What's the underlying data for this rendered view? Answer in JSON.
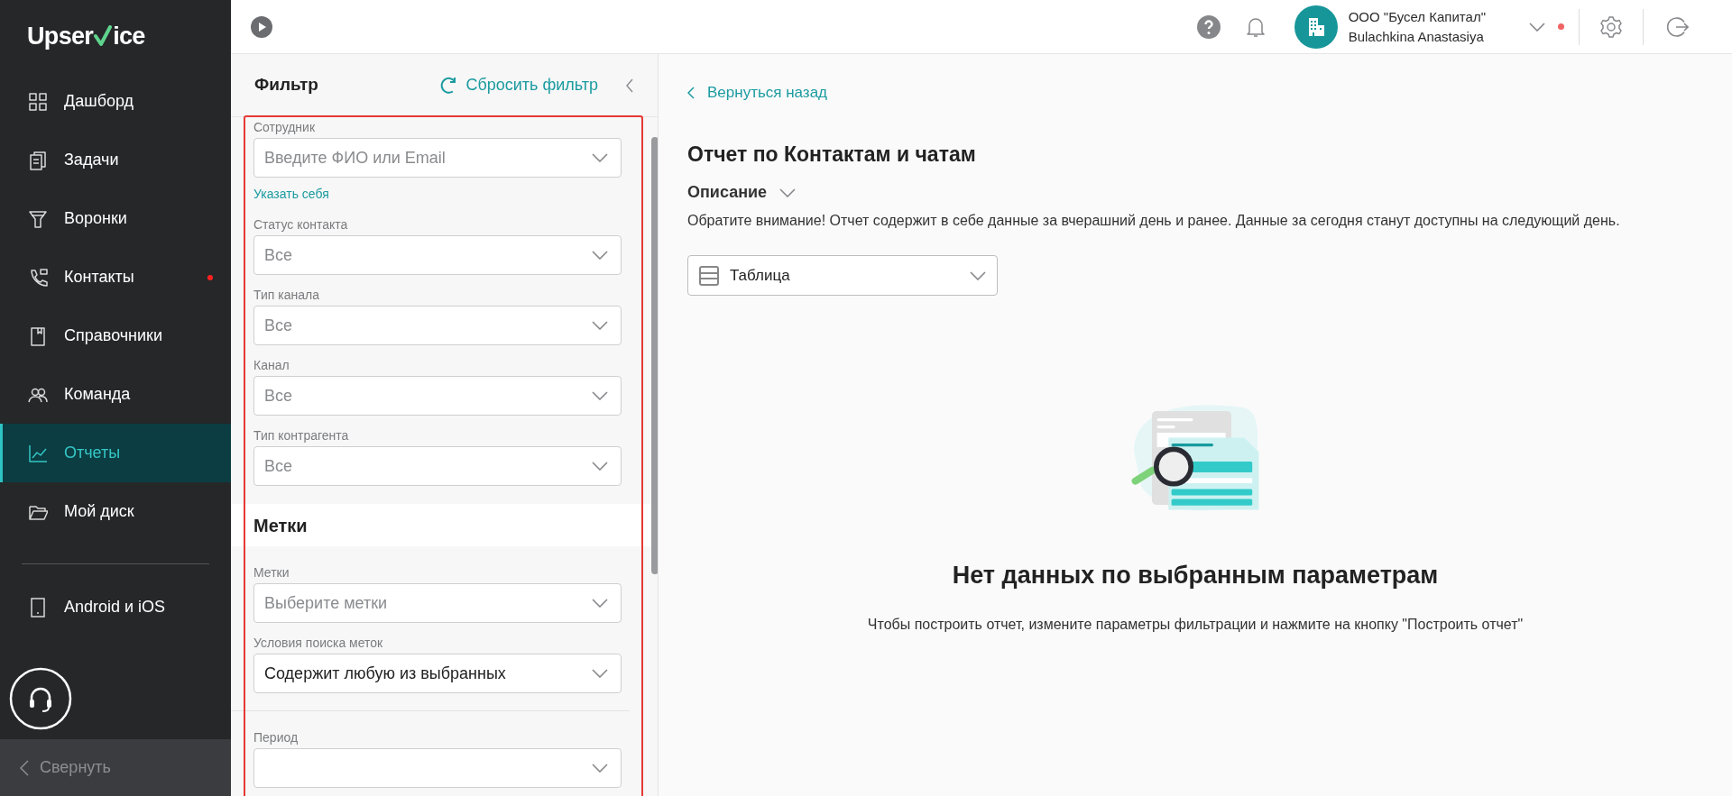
{
  "sidebar": {
    "logo": {
      "before": "Upser",
      "after": "ice"
    },
    "items": [
      {
        "label": "Дашборд",
        "selected": false,
        "dot": false
      },
      {
        "label": "Задачи",
        "selected": false,
        "dot": false
      },
      {
        "label": "Воронки",
        "selected": false,
        "dot": false
      },
      {
        "label": "Контакты",
        "selected": false,
        "dot": true
      },
      {
        "label": "Справочники",
        "selected": false,
        "dot": false
      },
      {
        "label": "Команда",
        "selected": false,
        "dot": false
      },
      {
        "label": "Отчеты",
        "selected": true,
        "dot": false
      },
      {
        "label": "Мой диск",
        "selected": false,
        "dot": false
      }
    ],
    "apps": "Android и iOS",
    "collapse": "Свернуть"
  },
  "topbar": {
    "company": "ООО \"Бусел Капитал\"",
    "user": "Bulachkina Anastasiya",
    "alert": true
  },
  "filter": {
    "title": "Фильтр",
    "reset": "Сбросить фильтр",
    "groups": [
      {
        "fields": [
          {
            "label": "Сотрудник",
            "placeholder": "Введите ФИО или Email",
            "link": "Указать себя"
          },
          {
            "label": "Статус контакта",
            "placeholder": "Все"
          },
          {
            "label": "Тип канала",
            "placeholder": "Все"
          },
          {
            "label": "Канал",
            "placeholder": "Все"
          },
          {
            "label": "Тип контрагента",
            "placeholder": "Все"
          }
        ]
      },
      {
        "heading": "Метки",
        "fields": [
          {
            "label": "Метки",
            "placeholder": "Выберите метки"
          },
          {
            "label": "Условия поиска меток",
            "value": "Содержит любую из выбранных"
          }
        ]
      },
      {
        "fields": [
          {
            "label": "Период"
          }
        ]
      }
    ]
  },
  "report": {
    "back": "Вернуться назад",
    "title": "Отчет по Контактам и чатам",
    "description_toggle": "Описание",
    "description": "Обратите внимание! Отчет содержит в себе данные за вчерашний день и ранее. Данные за сегодня станут доступны на следующий день.",
    "view": "Таблица",
    "empty_title": "Нет данных по выбранным параметрам",
    "empty_text": "Чтобы построить отчет, измените параметры фильтрации и нажмите на кнопку \"Построить отчет\""
  }
}
